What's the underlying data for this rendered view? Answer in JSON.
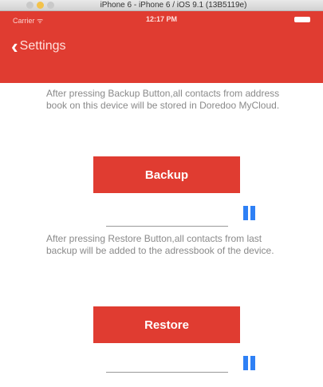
{
  "simulator": {
    "window_title": "iPhone 6 - iPhone 6 / iOS 9.1 (13B5119e)"
  },
  "status_bar": {
    "carrier": "Carrier ᯤ",
    "time": "12:17 PM"
  },
  "nav": {
    "back_label": "Settings"
  },
  "backup": {
    "description": "After pressing Backup Button,all contacts from address book on this device will be stored in Doredoo MyCloud.",
    "button_label": "Backup",
    "progress": 0
  },
  "restore": {
    "description": "After pressing Restore Button,all contacts from last backup will be added to the adressbook of the device.",
    "button_label": "Restore",
    "progress": 0
  },
  "colors": {
    "accent_red": "#e03c31",
    "pause_blue": "#2e80f5"
  },
  "icons": {
    "back": "chevron-left",
    "pause": "pause"
  }
}
